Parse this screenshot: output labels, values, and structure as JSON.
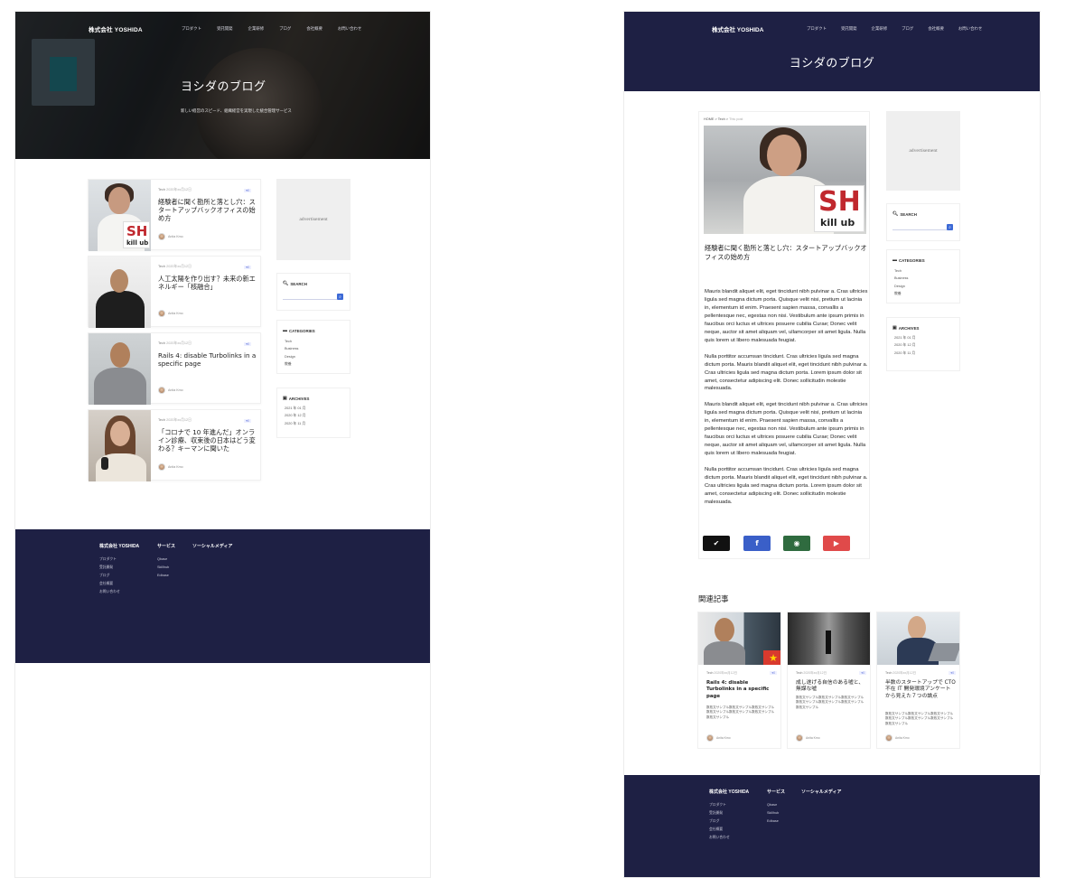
{
  "site": {
    "brand": "株式会社 YOSHIDA",
    "nav": [
      "プロダクト",
      "受託開発",
      "企業研修",
      "ブログ",
      "会社概要",
      "お問い合わせ"
    ]
  },
  "left": {
    "hero_title": "ヨシダのブログ",
    "hero_subtitle": "新しい経営のスピード、組織経営を実現した統合管理サービス",
    "posts": [
      {
        "category": "Tech",
        "date": "2020年xx月12日",
        "badge": "♥0",
        "title": "経験者に聞く勘所と落とし穴：スタートアップバックオフィスの始め方",
        "author": "Anita Kmo"
      },
      {
        "category": "Tech",
        "date": "2020年xx月12日",
        "badge": "♥0",
        "title": "人工太陽を作り出す？未来の新エネルギー「核融合」",
        "author": "Anita Kmo"
      },
      {
        "category": "Tech",
        "date": "2020年xx月12日",
        "badge": "♥0",
        "title": "Rails 4: disable Turbolinks in a specific page",
        "author": "Anita Kmo"
      },
      {
        "category": "Tech",
        "date": "2020年xx月12日",
        "badge": "♥0",
        "title": "「コロナで 10 年進んだ」オンライン診療、収束後の日本はどう変わる？キーマンに聞いた",
        "author": "Anita Kmo"
      }
    ],
    "advertisement": "advertisement",
    "search_title": "SEARCH",
    "categories_title": "CATEGORIES",
    "categories": [
      "Tech",
      "Business",
      "Design",
      "教養"
    ],
    "archives_title": "ARCHIVES",
    "archives": [
      "2021 年 01 月",
      "2020 年 12 月",
      "2020 年 11 月"
    ]
  },
  "thumb_logo": {
    "sh": "SH",
    "kill": "kill",
    "ub": "ub"
  },
  "footer": {
    "brand": "株式会社 YOSHIDA",
    "col1": [
      "プロダクト",
      "受託開発",
      "ブログ",
      "会社概要",
      "お問い合わせ"
    ],
    "services_title": "サービス",
    "services": [
      "Qbase",
      "Skillhub",
      "Edbase"
    ],
    "social_title": "ソーシャルメディア"
  },
  "right": {
    "title": "ヨシダのブログ",
    "breadcrumb": {
      "home": "HOME",
      "sep1": ">",
      "cat": "Tech",
      "sep2": ">",
      "current": "This post"
    },
    "article_title": "経験者に聞く勘所と落とし穴：スタートアップバックオフィスの始め方",
    "paragraphs": [
      "Mauris blandit aliquet elit, eget tincidunt nibh pulvinar a. Cras ultricies ligula sed magna dictum porta. Quisque velit nisi, pretium ut lacinia in, elementum id enim. Praesent sapien massa, convallis a pellentesque nec, egestas non nisi. Vestibulum ante ipsum primis in faucibus orci luctus et ultrices posuere cubilia Curae; Donec velit neque, auctor sit amet aliquam vel, ullamcorper sit amet ligula. Nulla quis lorem ut libero malesuada feugiat.",
      "Nulla porttitor accumsan tincidunt. Cras ultricies ligula sed magna dictum porta. Mauris blandit aliquet elit, eget tincidunt nibh pulvinar a. Cras ultricies ligula sed magna dictum porta. Lorem ipsum dolor sit amet, consectetur adipiscing elit. Donec sollicitudin molestie malesuada.",
      "Mauris blandit aliquet elit, eget tincidunt nibh pulvinar a. Cras ultricies ligula sed magna dictum porta. Quisque velit nisi, pretium ut lacinia in, elementum id enim. Praesent sapien massa, convallis a pellentesque nec, egestas non nisi. Vestibulum ante ipsum primis in faucibus orci luctus et ultrices posuere cubilia Curae; Donec velit neque, auctor sit amet aliquam vel, ullamcorper sit amet ligula. Nulla quis lorem ut libero malesuada feugiat.",
      "Nulla porttitor accumsan tincidunt. Cras ultricies ligula sed magna dictum porta. Mauris blandit aliquet elit, eget tincidunt nibh pulvinar a. Cras ultricies ligula sed magna dictum porta. Lorem ipsum dolor sit amet, consectetur adipiscing elit. Donec sollicitudin molestie malesuada."
    ],
    "share": [
      {
        "icon": "twitter-icon",
        "color": "#111111",
        "glyph": "🐦"
      },
      {
        "icon": "facebook-icon",
        "color": "#3a5fc8",
        "glyph": "f"
      },
      {
        "icon": "podcast-icon",
        "color": "#2f6b3f",
        "glyph": "◉"
      },
      {
        "icon": "youtube-icon",
        "color": "#e04a4a",
        "glyph": "▶"
      }
    ],
    "related_title": "関連記事",
    "related": [
      {
        "category": "Tech",
        "date": "2020年xx月12日",
        "badge": "♥0",
        "title": "Rails 4: disable Turbolinks in a specific page",
        "excerpt": "数枚文サンプル数枚文サンプル数枚文サンプル数枚文サンプル数枚文サンプル数枚文サンプル数枚文サンプル",
        "author": "Anita Kmo"
      },
      {
        "category": "Tech",
        "date": "2020年xx月12日",
        "badge": "♥0",
        "title": "成し遂げる自信のある嘘と、無謀な嘘",
        "excerpt": "数枚文サンプル数枚文サンプル数枚文サンプル数枚文サンプル数枚文サンプル数枚文サンプル数枚文サンプル",
        "author": "Anita Kmo"
      },
      {
        "category": "Tech",
        "date": "2020年xx月12日",
        "badge": "♥0",
        "title": "半数のスタートアップで CTO 不在 IT 開発環境アンケートから見えた７つの論点",
        "excerpt": "数枚文サンプル数枚文サンプル数枚文サンプル数枚文サンプル数枚文サンプル数枚文サンプル数枚文サンプル",
        "author": "Anita Kmo"
      }
    ]
  }
}
